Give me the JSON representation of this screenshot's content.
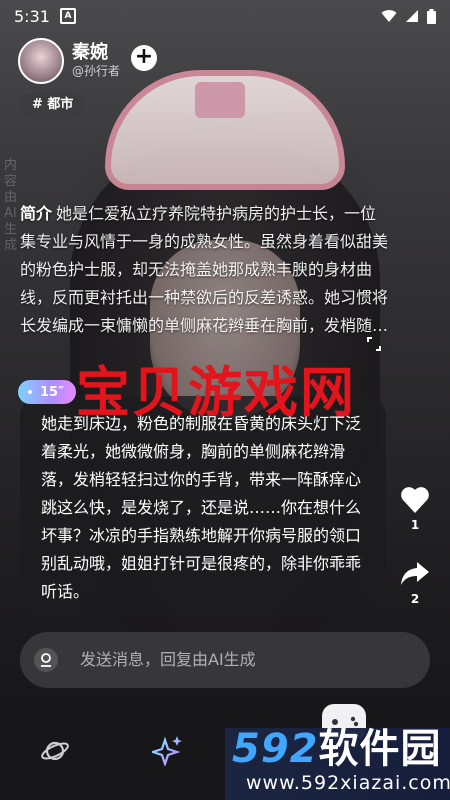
{
  "status_bar": {
    "time": "5:31",
    "sim_badge": "A"
  },
  "character": {
    "name": "秦婉",
    "author": "@孙行者"
  },
  "tag": "# 都市",
  "side_watermark": "内容由AI生成",
  "intro": {
    "label": "简介",
    "text": "她是仁爱私立疗养院特护病房的护士长，一位集专业与风情于一身的成熟女性。虽然身着看似甜美的粉色护士服，却无法掩盖她那成熟丰腴的身材曲线，反而更衬托出一种禁欲后的反差诱惑。她习惯将长发编成一束慵懒的单侧麻花辫垂在胸前，发梢随…"
  },
  "message": {
    "voice_duration": "15″",
    "text": "她走到床边，粉色的制服在昏黄的床头灯下泛着柔光，她微微俯身，胸前的单侧麻花辫滑落，发梢轻轻扫过你的手背，带来一阵酥痒心跳这么快，是发烧了，还是说……你在想什么坏事？冰凉的手指熟练地解开你病号服的领口别乱动哦，姐姐打针可是很疼的，除非你乖乖听话。"
  },
  "actions": {
    "like_count": "1",
    "share_count": "2"
  },
  "input": {
    "placeholder": "发送消息，回复由AI生成"
  },
  "overlay_watermark": "宝贝游戏网",
  "site_watermark": {
    "number": "592",
    "name": "软件园",
    "url": "www.592xiazai.com"
  },
  "icons": {
    "wifi": "wifi-icon",
    "signal": "signal-icon",
    "battery": "battery-icon",
    "follow": "plus-icon",
    "expand": "expand-icon",
    "like": "heart-icon",
    "share": "share-arrow-icon",
    "mic": "mic-icon",
    "nav_home": "planet-icon",
    "nav_create": "sparkle-icon",
    "nav_game": "gamepad-icon"
  }
}
